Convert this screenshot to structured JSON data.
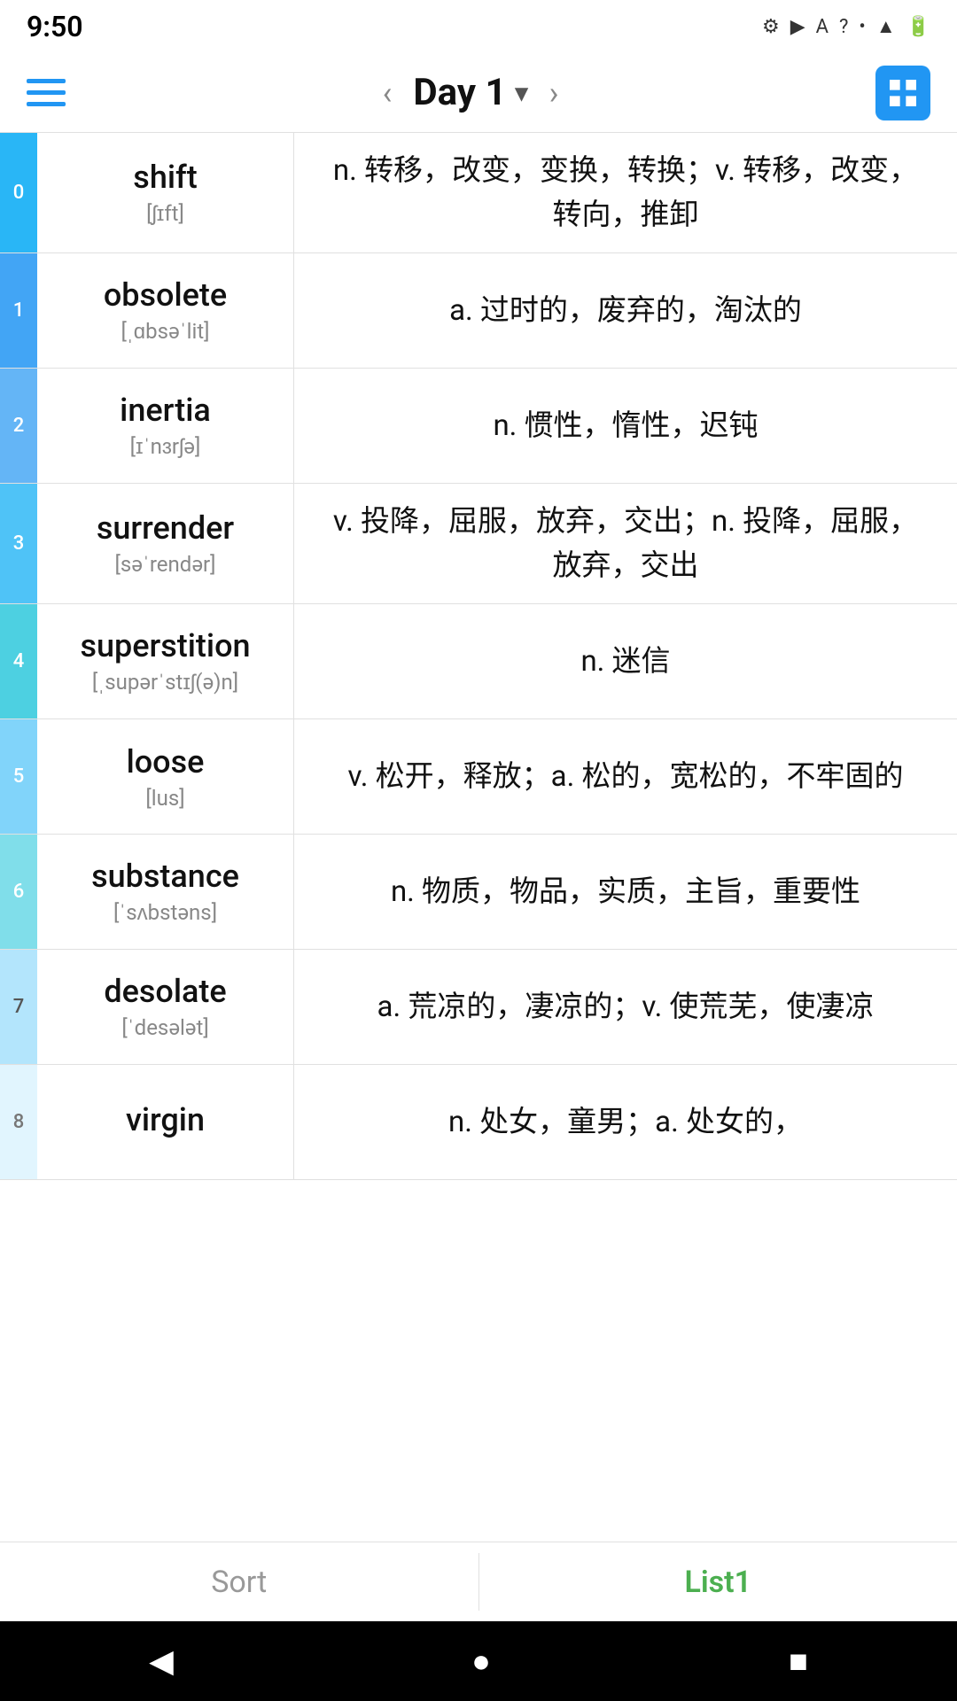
{
  "statusBar": {
    "time": "9:50",
    "icons": [
      "⚙",
      "▶",
      "A",
      "?",
      "•",
      "▲",
      "🔋"
    ]
  },
  "navbar": {
    "title": "Day 1",
    "prevLabel": "‹",
    "nextLabel": "›",
    "dropdownIcon": "▾"
  },
  "words": [
    {
      "index": "0",
      "english": "shift",
      "phonetic": "[ʃɪft]",
      "definition": "n. 转移，改变，变换，转换；v. 转移，改变，转向，推卸",
      "colorClass": "idx-0"
    },
    {
      "index": "1",
      "english": "obsolete",
      "phonetic": "[ˌɑbsəˈlit]",
      "definition": "a. 过时的，废弃的，淘汰的",
      "colorClass": "idx-1"
    },
    {
      "index": "2",
      "english": "inertia",
      "phonetic": "[ɪˈnɜrʃə]",
      "definition": "n. 惯性，惰性，迟钝",
      "colorClass": "idx-2"
    },
    {
      "index": "3",
      "english": "surrender",
      "phonetic": "[səˈrendər]",
      "definition": "v. 投降，屈服，放弃，交出；n. 投降，屈服，放弃，交出",
      "colorClass": "idx-3"
    },
    {
      "index": "4",
      "english": "superstition",
      "phonetic": "[ˌsupərˈstɪʃ(ə)n]",
      "definition": "n. 迷信",
      "colorClass": "idx-4"
    },
    {
      "index": "5",
      "english": "loose",
      "phonetic": "[lus]",
      "definition": "v. 松开，释放；a. 松的，宽松的，不牢固的",
      "colorClass": "idx-5"
    },
    {
      "index": "6",
      "english": "substance",
      "phonetic": "[ˈsʌbstəns]",
      "definition": "n. 物质，物品，实质，主旨，重要性",
      "colorClass": "idx-6"
    },
    {
      "index": "7",
      "english": "desolate",
      "phonetic": "[ˈdesələt]",
      "definition": "a. 荒凉的，凄凉的；v. 使荒芜，使凄凉",
      "colorClass": "idx-7"
    },
    {
      "index": "8",
      "english": "virgin",
      "phonetic": "",
      "definition": "n. 处女，童男；a. 处女的，",
      "colorClass": "idx-8"
    }
  ],
  "bottomTabs": [
    {
      "label": "Sort",
      "active": false
    },
    {
      "label": "List1",
      "active": true
    }
  ],
  "androidNav": {
    "back": "◀",
    "home": "●",
    "recent": "■"
  }
}
